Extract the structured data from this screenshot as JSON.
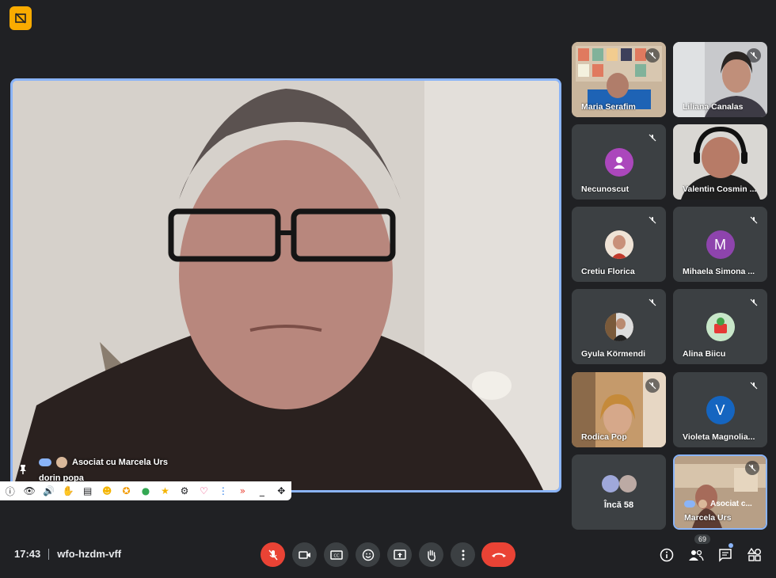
{
  "meeting": {
    "time": "17:43",
    "code": "wfo-hzdm-vff",
    "participant_count": "69"
  },
  "main_speaker": {
    "associated_label": "Asociat cu Marcela Urs",
    "name": "dorin popa"
  },
  "participants": [
    {
      "name": "Maria Serafim",
      "muted": true,
      "type": "video"
    },
    {
      "name": "Liliana Canalas",
      "muted": true,
      "type": "video"
    },
    {
      "name": "Necunoscut",
      "muted": true,
      "type": "avatar-generic",
      "color": "#ab47bc"
    },
    {
      "name": "Valentin Cosmin ...",
      "muted": false,
      "type": "video"
    },
    {
      "name": "Cretiu Florica",
      "muted": true,
      "type": "avatar-photo"
    },
    {
      "name": "Mihaela Simona ...",
      "muted": true,
      "type": "avatar-letter",
      "letter": "M",
      "color": "#8e44ad"
    },
    {
      "name": "Gyula Körmendi",
      "muted": true,
      "type": "avatar-photo"
    },
    {
      "name": "Alina Biicu",
      "muted": true,
      "type": "avatar-photo"
    },
    {
      "name": "Rodica Pop",
      "muted": true,
      "type": "video"
    },
    {
      "name": "Violeta Magnolia...",
      "muted": true,
      "type": "avatar-letter",
      "letter": "V",
      "color": "#1565c0"
    }
  ],
  "more_tile": {
    "label": "Încă 58"
  },
  "self_tile": {
    "associated_label": "Asociat c...",
    "name": "Marcela Urs"
  },
  "toolbar_icons": [
    "info-icon",
    "eye-icon",
    "speaker-icon",
    "hand-icon",
    "notes-icon",
    "emoji-icon",
    "badge-icon",
    "chat-bubble-icon",
    "star-icon",
    "gear-icon",
    "heart-icon",
    "more-icon",
    "forward-icon",
    "minimize-icon",
    "move-icon"
  ],
  "colors": {
    "accent": "#8ab4f8",
    "danger": "#ea4335",
    "background": "#202124",
    "tile": "#3c4043",
    "warning": "#f9ab00"
  }
}
